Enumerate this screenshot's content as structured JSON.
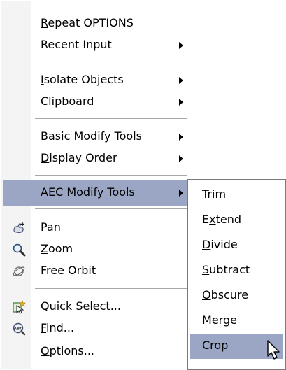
{
  "main_menu": {
    "items": [
      {
        "label": "Repeat OPTIONS",
        "ul": 0
      },
      {
        "label": "Recent Input",
        "submenu": true
      },
      {
        "label": "Isolate Objects",
        "ul": 0,
        "submenu": true
      },
      {
        "label": "Clipboard",
        "ul": 0,
        "submenu": true
      },
      {
        "label": "Basic Modify Tools",
        "ul": 6,
        "submenu": true
      },
      {
        "label": "Display Order",
        "ul": 0,
        "submenu": true
      },
      {
        "label": "AEC Modify Tools",
        "ul": 0,
        "submenu": true
      },
      {
        "label": "Pan",
        "ul": 2,
        "icon": "pan-hand-icon"
      },
      {
        "label": "Zoom",
        "ul": 0,
        "icon": "zoom-magnifier-icon"
      },
      {
        "label": "Free Orbit",
        "icon": "orbit-icon"
      },
      {
        "label": "Quick Select...",
        "ul": 0,
        "icon": "quick-select-icon"
      },
      {
        "label": "Find...",
        "ul": 0,
        "icon": "find-text-icon"
      },
      {
        "label": "Options...",
        "ul": 0
      }
    ]
  },
  "sub_menu": {
    "items": [
      {
        "label": "Trim",
        "ul": 0
      },
      {
        "label": "Extend",
        "ul": 1
      },
      {
        "label": "Divide",
        "ul": 0
      },
      {
        "label": "Subtract",
        "ul": 0
      },
      {
        "label": "Obscure",
        "ul": 0
      },
      {
        "label": "Merge",
        "ul": 0
      },
      {
        "label": "Crop",
        "ul": 0
      }
    ]
  },
  "highlight_color": "#9aa6c4"
}
